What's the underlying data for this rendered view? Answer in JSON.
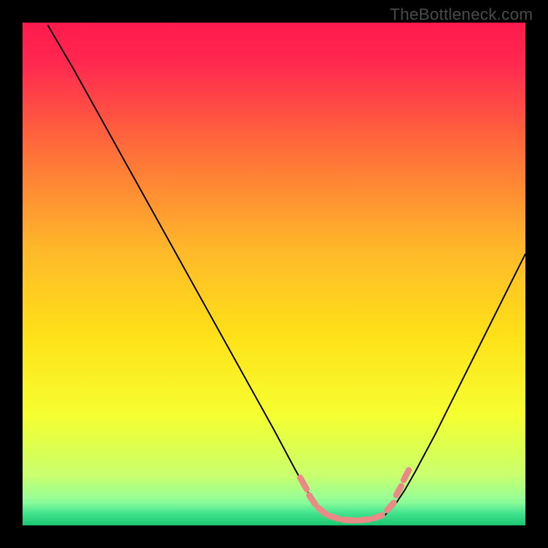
{
  "watermark": "TheBottleneck.com",
  "chart_data": {
    "type": "line",
    "title": "",
    "xlabel": "",
    "ylabel": "",
    "xlim": [
      0,
      100
    ],
    "ylim": [
      0,
      100
    ],
    "gradient_stops": [
      {
        "offset": 0.0,
        "color": "#ff1a4d"
      },
      {
        "offset": 0.08,
        "color": "#ff2850"
      },
      {
        "offset": 0.25,
        "color": "#ff6d3a"
      },
      {
        "offset": 0.45,
        "color": "#ffb82a"
      },
      {
        "offset": 0.62,
        "color": "#ffe018"
      },
      {
        "offset": 0.78,
        "color": "#f5ff30"
      },
      {
        "offset": 0.9,
        "color": "#c8ff6a"
      },
      {
        "offset": 0.955,
        "color": "#8aff9a"
      },
      {
        "offset": 0.975,
        "color": "#40e890"
      },
      {
        "offset": 1.0,
        "color": "#18c872"
      }
    ],
    "series": [
      {
        "name": "bottleneck-curve",
        "color": "#000000",
        "points": [
          {
            "x": 5.0,
            "y": 99.5
          },
          {
            "x": 10.0,
            "y": 91.0
          },
          {
            "x": 15.0,
            "y": 82.0
          },
          {
            "x": 20.0,
            "y": 73.0
          },
          {
            "x": 25.0,
            "y": 64.0
          },
          {
            "x": 30.0,
            "y": 55.0
          },
          {
            "x": 35.0,
            "y": 46.0
          },
          {
            "x": 40.0,
            "y": 37.0
          },
          {
            "x": 45.0,
            "y": 28.0
          },
          {
            "x": 50.0,
            "y": 19.0
          },
          {
            "x": 54.0,
            "y": 11.5
          },
          {
            "x": 56.5,
            "y": 7.0
          },
          {
            "x": 58.0,
            "y": 4.5
          },
          {
            "x": 60.0,
            "y": 2.5
          },
          {
            "x": 62.0,
            "y": 1.5
          },
          {
            "x": 65.0,
            "y": 1.0
          },
          {
            "x": 68.0,
            "y": 1.0
          },
          {
            "x": 70.0,
            "y": 1.3
          },
          {
            "x": 72.0,
            "y": 2.0
          },
          {
            "x": 74.0,
            "y": 4.0
          },
          {
            "x": 76.0,
            "y": 7.0
          },
          {
            "x": 78.0,
            "y": 10.5
          },
          {
            "x": 82.0,
            "y": 18.0
          },
          {
            "x": 86.0,
            "y": 26.0
          },
          {
            "x": 90.0,
            "y": 34.0
          },
          {
            "x": 95.0,
            "y": 44.0
          },
          {
            "x": 100.0,
            "y": 54.0
          }
        ]
      },
      {
        "name": "optimal-range-markers",
        "color": "#e98a86",
        "type": "scatter-dash",
        "segments": [
          {
            "x1": 55.2,
            "y1": 9.5,
            "x2": 56.5,
            "y2": 7.2
          },
          {
            "x1": 57.0,
            "y1": 6.0,
            "x2": 58.2,
            "y2": 4.2
          },
          {
            "x1": 58.8,
            "y1": 3.5,
            "x2": 60.3,
            "y2": 2.3
          },
          {
            "x1": 61.0,
            "y1": 1.9,
            "x2": 63.0,
            "y2": 1.3
          },
          {
            "x1": 63.8,
            "y1": 1.1,
            "x2": 66.0,
            "y2": 1.0
          },
          {
            "x1": 66.8,
            "y1": 1.0,
            "x2": 69.0,
            "y2": 1.2
          },
          {
            "x1": 69.8,
            "y1": 1.4,
            "x2": 71.5,
            "y2": 2.0
          },
          {
            "x1": 72.5,
            "y1": 3.0,
            "x2": 73.8,
            "y2": 4.5
          },
          {
            "x1": 74.3,
            "y1": 6.0,
            "x2": 75.3,
            "y2": 7.8
          },
          {
            "x1": 75.8,
            "y1": 9.0,
            "x2": 76.8,
            "y2": 11.0
          }
        ]
      }
    ]
  }
}
